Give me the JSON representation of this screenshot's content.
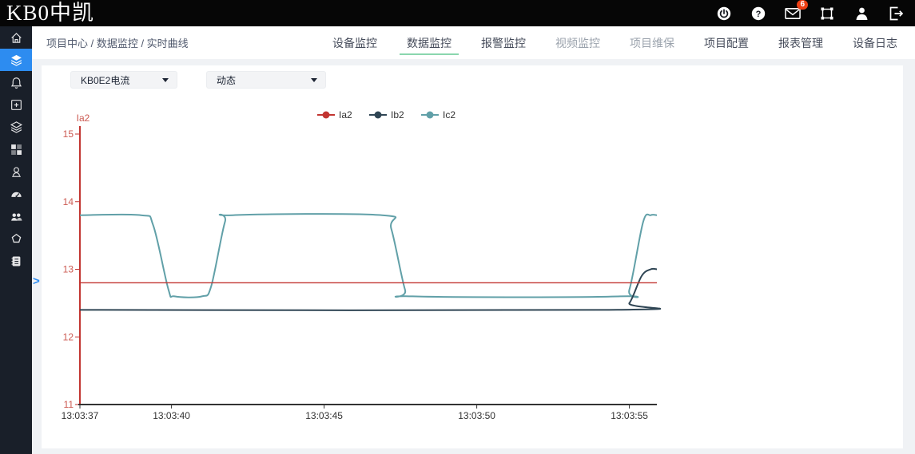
{
  "header": {
    "logo": "KB0中凯",
    "mail_badge_count": "6",
    "icons": [
      "power-icon",
      "help-icon",
      "mail-icon",
      "fullscreen-icon",
      "user-icon",
      "logout-icon"
    ]
  },
  "sidebar": {
    "active_index": 1,
    "icons": [
      "home-icon",
      "layers-icon",
      "bell-icon",
      "add-panel-icon",
      "stack-icon",
      "dashboard-icon",
      "operator-icon",
      "gauge-icon",
      "team-icon",
      "pentagon-icon",
      "logbook-icon"
    ],
    "expand_arrow": ">"
  },
  "breadcrumb": "项目中心 / 数据监控 / 实时曲线",
  "nav": {
    "tabs": [
      {
        "key": "device-monitoring",
        "label": "设备监控",
        "active": false,
        "muted": false
      },
      {
        "key": "data-monitoring",
        "label": "数据监控",
        "active": true,
        "muted": false
      },
      {
        "key": "alarm-monitoring",
        "label": "报警监控",
        "active": false,
        "muted": false
      },
      {
        "key": "video-monitoring",
        "label": "视频监控",
        "active": false,
        "muted": true
      },
      {
        "key": "project-maintenance",
        "label": "项目维保",
        "active": false,
        "muted": true
      },
      {
        "key": "project-configuration",
        "label": "项目配置",
        "active": false,
        "muted": false
      },
      {
        "key": "report-management",
        "label": "报表管理",
        "active": false,
        "muted": false
      },
      {
        "key": "device-logs",
        "label": "设备日志",
        "active": false,
        "muted": false
      }
    ]
  },
  "filters": {
    "device": {
      "value": "KB0E2电流"
    },
    "mode": {
      "value": "动态"
    }
  },
  "chart_data": {
    "type": "line",
    "title": "",
    "legend": [
      "Ia2",
      "Ib2",
      "Ic2"
    ],
    "legend_position": "top-center",
    "grid": false,
    "y_axis": {
      "name": "Ia2",
      "min": 11,
      "max": 15,
      "ticks": [
        11,
        12,
        13,
        14,
        15
      ],
      "axis_color": "#c23531",
      "label_color": "#cc5a52"
    },
    "x_axis": {
      "unit": "time",
      "start": "13:03:37",
      "t_end": 18.9,
      "axis_color": "#333333",
      "label_color": "#333333",
      "ticks": [
        {
          "t": 0,
          "label": "13:03:37"
        },
        {
          "t": 3,
          "label": "13:03:40"
        },
        {
          "t": 8,
          "label": "13:03:45"
        },
        {
          "t": 13,
          "label": "13:03:50"
        },
        {
          "t": 18,
          "label": "13:03:55"
        }
      ]
    },
    "series": [
      {
        "name": "Ia2",
        "color": "#c23531",
        "width": 1.4,
        "points": [
          [
            0,
            12.8
          ],
          [
            18.9,
            12.8
          ]
        ]
      },
      {
        "name": "Ib2",
        "color": "#2f4554",
        "width": 2,
        "points": [
          [
            0,
            12.4
          ],
          [
            17.6,
            12.4
          ],
          [
            18.0,
            12.5
          ],
          [
            18.4,
            12.9
          ],
          [
            18.7,
            13.0
          ],
          [
            18.9,
            13.0
          ]
        ]
      },
      {
        "name": "Ic2",
        "color": "#61a0a8",
        "width": 2,
        "points": [
          [
            0,
            13.8
          ],
          [
            2.0,
            13.8
          ],
          [
            2.4,
            13.65
          ],
          [
            2.9,
            12.7
          ],
          [
            3.1,
            12.6
          ],
          [
            4.0,
            12.6
          ],
          [
            4.3,
            12.75
          ],
          [
            4.75,
            13.7
          ],
          [
            5.0,
            13.8
          ],
          [
            9.9,
            13.8
          ],
          [
            10.2,
            13.6
          ],
          [
            10.65,
            12.7
          ],
          [
            10.9,
            12.6
          ],
          [
            17.7,
            12.6
          ],
          [
            18.0,
            12.7
          ],
          [
            18.45,
            13.7
          ],
          [
            18.7,
            13.8
          ],
          [
            18.9,
            13.8
          ]
        ]
      }
    ]
  }
}
